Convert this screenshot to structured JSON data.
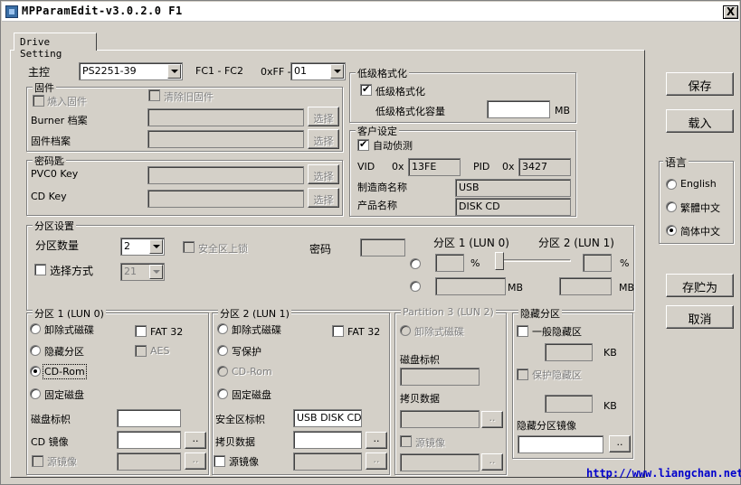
{
  "window": {
    "title": "MPParamEdit-v3.0.2.0 F1",
    "close": "X"
  },
  "tab": "Drive Setting",
  "controller": {
    "label": "主控",
    "value": "PS2251-39",
    "fc": "FC1 - FC2",
    "oxff_label": "0xFF -",
    "oxff_value": "01"
  },
  "firmware": {
    "title": "固件",
    "burn_label": "燒入固件",
    "clear_label": "清除旧固件",
    "burner_label": "Burner 档案",
    "firmware_file_label": "固件档案",
    "browse": "选择"
  },
  "key": {
    "title": "密码匙",
    "pvc0_label": "PVC0 Key",
    "cd_label": "CD Key",
    "browse": "选择"
  },
  "lowformat": {
    "title": "低级格式化",
    "enable_label": "低级格式化",
    "capacity_label": "低级格式化容量",
    "capacity_value": "",
    "unit": "MB"
  },
  "customer": {
    "title": "客户设定",
    "auto_detect": "自动侦测",
    "vid_label": "VID",
    "pid_label": "PID",
    "hex_prefix": "0x",
    "vid": "13FE",
    "pid": "3427",
    "vendor_label": "制造商名称",
    "vendor": "USB",
    "product_label": "产品名称",
    "product": "DISK CD"
  },
  "partition": {
    "title": "分区设置",
    "count_label": "分区数量",
    "count_value": "2",
    "secure_lock": "安全区上锁",
    "mode_label": "选择方式",
    "mode_value": "21",
    "password_label": "密码",
    "lun0_label": "分区 1 (LUN 0)",
    "lun1_label": "分区 2 (LUN 1)",
    "percent": "%",
    "mb": "MB"
  },
  "lun0": {
    "title": "分区 1 (LUN 0)",
    "removable": "卸除式磁碟",
    "fat32": "FAT 32",
    "hidden": "隐藏分区",
    "aes": "AES",
    "cdrom": "CD-Rom",
    "fixed": "固定磁盘",
    "volume_label": "磁盘标帜",
    "volume_value": "",
    "cd_image_label": "CD 镜像",
    "source_image": "源镜像",
    "dots": ".."
  },
  "lun1": {
    "title": "分区 2 (LUN 1)",
    "removable": "卸除式磁碟",
    "fat32": "FAT 32",
    "write_protect": "写保护",
    "cdrom": "CD-Rom",
    "fixed": "固定磁盘",
    "secure_label": "安全区标帜",
    "secure_value": "USB DISK CD",
    "copy_label": "拷贝数据",
    "source_image": "源镜像",
    "dots": ".."
  },
  "lun2": {
    "title": "Partition 3 (LUN 2)",
    "removable": "卸除式磁碟",
    "volume_label": "磁盘标帜",
    "copy_label": "拷贝数据",
    "source_image": "源镜像",
    "dots": ".."
  },
  "hidden": {
    "title": "隐藏分区",
    "normal": "一般隐藏区",
    "protect": "保护隐藏区",
    "kb": "KB",
    "image_label": "隐藏分区镜像",
    "dots": ".."
  },
  "buttons": {
    "save": "保存",
    "load": "载入",
    "save_as": "存贮为",
    "cancel": "取消"
  },
  "language": {
    "title": "语言",
    "english": "English",
    "trad": "繁體中文",
    "simp": "简体中文"
  },
  "footer_link": "http://www.liangchan.net"
}
